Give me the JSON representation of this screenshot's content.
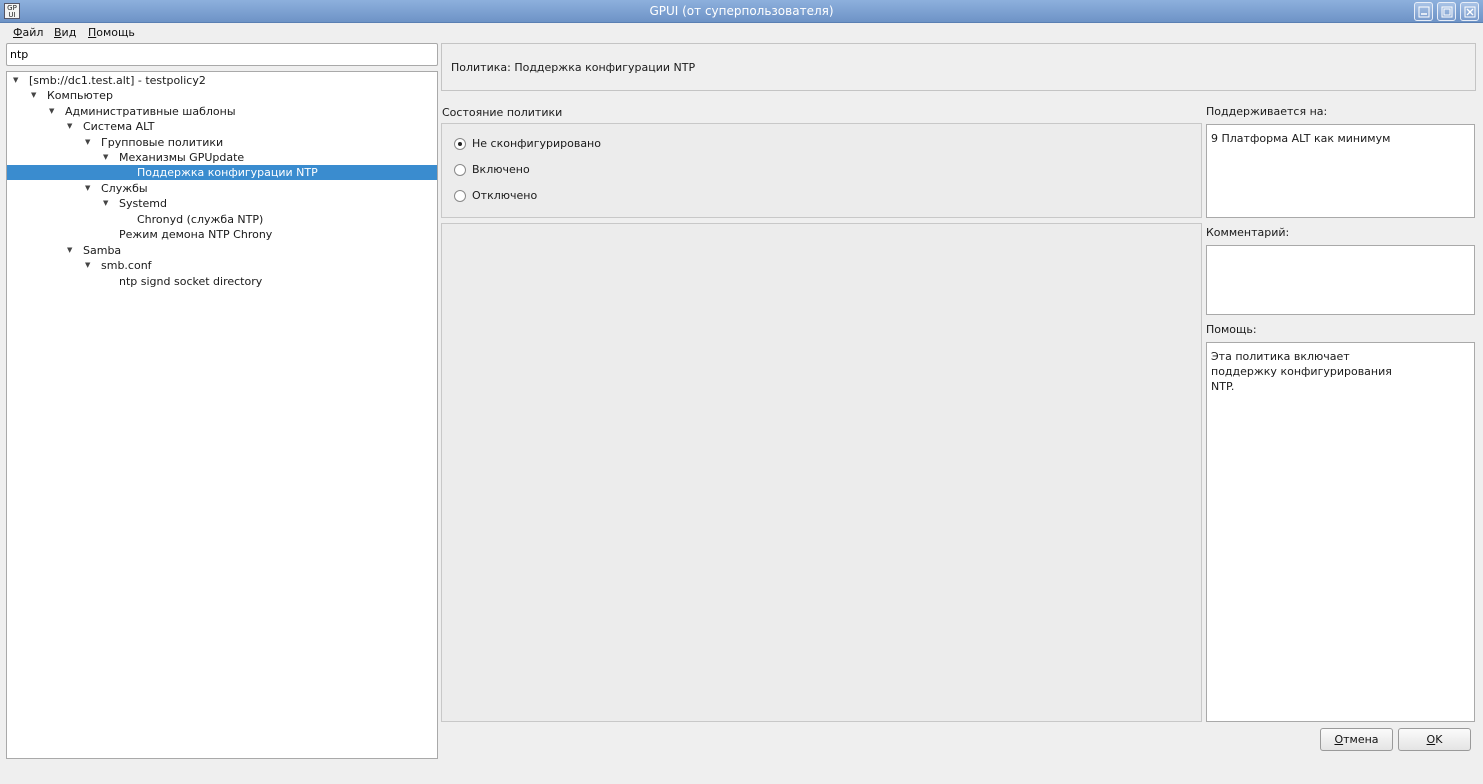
{
  "window": {
    "title": "GPUI (от суперпользователя)",
    "icon_text": "GP UI",
    "controls": [
      "minimize-icon",
      "maximize-icon",
      "close-icon"
    ]
  },
  "menubar": {
    "file": {
      "accel": "Ф",
      "rest": "айл"
    },
    "view": {
      "accel": "В",
      "rest": "ид"
    },
    "help": {
      "accel": "П",
      "rest": "омощь"
    }
  },
  "search": {
    "value": "ntp"
  },
  "tree": {
    "items": [
      {
        "label": "[smb://dc1.test.alt] - testpolicy2",
        "expanded": true
      },
      {
        "label": "Компьютер",
        "expanded": true
      },
      {
        "label": "Административные шаблоны",
        "expanded": true
      },
      {
        "label": "Система ALT",
        "expanded": true
      },
      {
        "label": "Групповые политики",
        "expanded": true
      },
      {
        "label": "Механизмы GPUpdate",
        "expanded": true
      },
      {
        "label": "Поддержка конфигурации NTP",
        "selected": true
      },
      {
        "label": "Службы",
        "expanded": true
      },
      {
        "label": "Systemd",
        "expanded": true
      },
      {
        "label": "Chronyd (служба NTP)"
      },
      {
        "label": "Режим демона NTP Chrony"
      },
      {
        "label": "Samba",
        "expanded": true
      },
      {
        "label": "smb.conf",
        "expanded": true
      },
      {
        "label": "ntp signd socket directory"
      }
    ]
  },
  "policy": {
    "header": "Политика: Поддержка конфигурации NTP",
    "state_label": "Состояние политики",
    "state_options": [
      {
        "label": "Не сконфигурировано",
        "checked": true
      },
      {
        "label": "Включено",
        "checked": false
      },
      {
        "label": "Отключено",
        "checked": false
      }
    ]
  },
  "side": {
    "supported_label": "Поддерживается на:",
    "supported_value": "9 Платформа ALT как минимум",
    "comment_label": "Комментарий:",
    "comment_value": "",
    "help_label": "Помощь:",
    "help_value": "Эта политика включает поддержку конфигурирования NTP."
  },
  "buttons": {
    "cancel": {
      "accel": "О",
      "rest": "тмена"
    },
    "ok": {
      "accel": "O",
      "rest": "K"
    }
  },
  "colors": {
    "titlebar": "#7a9ccd",
    "selection": "#3a8ccf"
  }
}
